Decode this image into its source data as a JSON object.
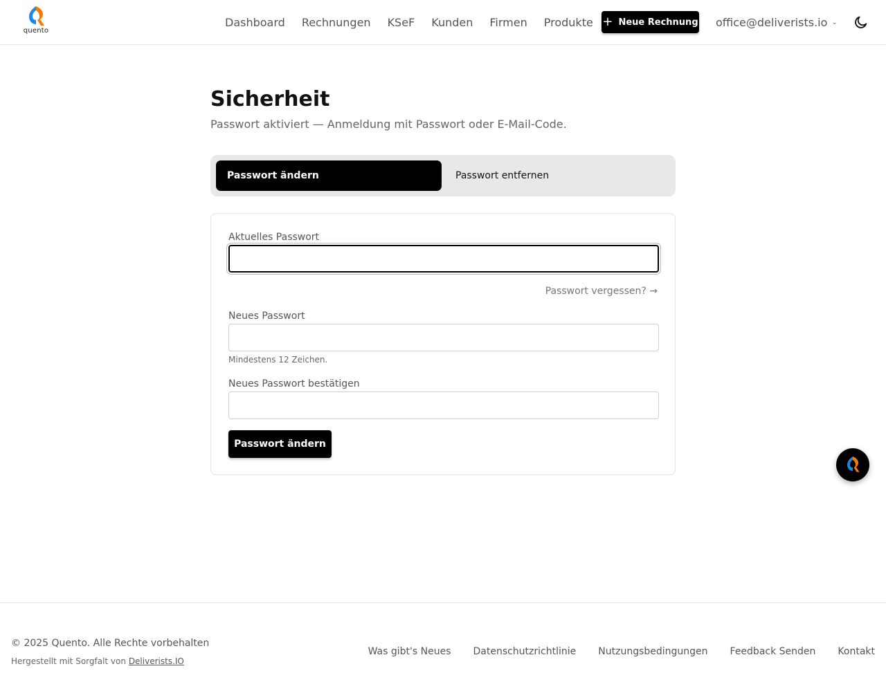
{
  "header": {
    "logo_text": "quento",
    "nav": [
      "Dashboard",
      "Rechnungen",
      "KSeF",
      "Kunden",
      "Firmen",
      "Produkte"
    ],
    "new_invoice_label": "Neue Rechnung",
    "account_email": "office@deliverists.io",
    "theme_icon": "moon-icon"
  },
  "page": {
    "title": "Sicherheit",
    "subtitle": "Passwort aktiviert — Anmeldung mit Passwort oder E-Mail-Code."
  },
  "tabs": [
    {
      "label": "Passwort ändern",
      "active": true
    },
    {
      "label": "Passwort entfernen",
      "active": false
    }
  ],
  "form": {
    "current_label": "Aktuelles Passwort",
    "current_value": "",
    "forgot_link": "Passwort vergessen? →",
    "new_label": "Neues Passwort",
    "new_value": "",
    "new_hint": "Mindestens 12 Zeichen.",
    "confirm_label": "Neues Passwort bestätigen",
    "confirm_value": "",
    "submit_label": "Passwort ändern"
  },
  "footer": {
    "copyright": "© 2025 Quento. Alle Rechte vorbehalten",
    "made_prefix": "Hergestellt mit Sorgfalt von",
    "made_link": "Deliverists.IO",
    "links": [
      "Was gibt's Neues",
      "Datenschutzrichtlinie",
      "Nutzungsbedingungen",
      "Feedback Senden",
      "Kontakt"
    ]
  },
  "colors": {
    "brand_blue": "#1e88e5",
    "brand_orange": "#f57c00",
    "primary": "#000000"
  }
}
